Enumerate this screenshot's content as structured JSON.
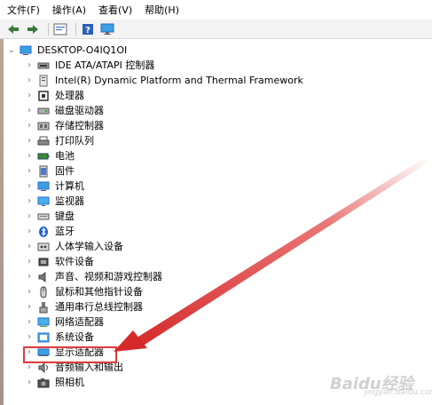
{
  "menu": [
    "文件(F)",
    "操作(A)",
    "查看(V)",
    "帮助(H)"
  ],
  "toolbar": {
    "icons": [
      "back-arrow-icon",
      "forward-arrow-icon",
      "properties-icon",
      "help-icon",
      "computer-icon"
    ]
  },
  "tree": {
    "root": "DESKTOP-O4IQ1OI",
    "items": [
      {
        "label": "IDE ATA/ATAPI 控制器",
        "icon": "ide-controller-icon"
      },
      {
        "label": "Intel(R) Dynamic Platform and Thermal Framework",
        "icon": "thermal-framework-icon"
      },
      {
        "label": "处理器",
        "icon": "processor-icon"
      },
      {
        "label": "磁盘驱动器",
        "icon": "disk-drive-icon"
      },
      {
        "label": "存储控制器",
        "icon": "storage-controller-icon"
      },
      {
        "label": "打印队列",
        "icon": "printer-icon"
      },
      {
        "label": "电池",
        "icon": "battery-icon"
      },
      {
        "label": "固件",
        "icon": "firmware-icon"
      },
      {
        "label": "计算机",
        "icon": "computer-icon"
      },
      {
        "label": "监视器",
        "icon": "monitor-icon"
      },
      {
        "label": "键盘",
        "icon": "keyboard-icon"
      },
      {
        "label": "蓝牙",
        "icon": "bluetooth-icon"
      },
      {
        "label": "人体学输入设备",
        "icon": "hid-icon"
      },
      {
        "label": "软件设备",
        "icon": "software-device-icon"
      },
      {
        "label": "声音、视频和游戏控制器",
        "icon": "sound-icon"
      },
      {
        "label": "鼠标和其他指针设备",
        "icon": "mouse-icon"
      },
      {
        "label": "通用串行总线控制器",
        "icon": "usb-icon"
      },
      {
        "label": "网络适配器",
        "icon": "network-adapter-icon"
      },
      {
        "label": "系统设备",
        "icon": "system-device-icon"
      },
      {
        "label": "显示适配器",
        "icon": "display-adapter-icon"
      },
      {
        "label": "音频输入和输出",
        "icon": "audio-io-icon"
      },
      {
        "label": "照相机",
        "icon": "camera-icon"
      }
    ]
  },
  "watermark": {
    "text": "Baidu经验",
    "sub": "jingyan.baidu.com"
  },
  "colors": {
    "annotation": "#e03a3a"
  }
}
